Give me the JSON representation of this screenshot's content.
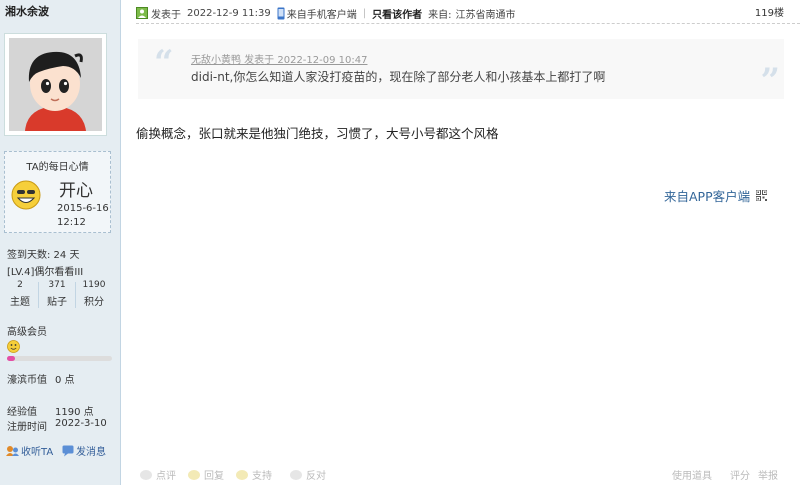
{
  "sidebar": {
    "username": "湘水余波",
    "mood": {
      "title": "TA的每日心情",
      "text": "开心",
      "date": "2015-6-16",
      "time": "12:12"
    },
    "sign_days": "签到天数: 24 天",
    "level": "[LV.4]偶尔看看III",
    "stats": [
      {
        "value": "2",
        "label": "主题"
      },
      {
        "value": "371",
        "label": "贴子"
      },
      {
        "value": "1190",
        "label": "积分"
      }
    ],
    "vip_label": "高级会员",
    "vip_progress": 0.08,
    "coins": {
      "label": "濠滨币值",
      "value": "0 点"
    },
    "exp": {
      "label": "经验值",
      "value": "1190 点"
    },
    "register": {
      "label": "注册时间",
      "value": "2022-3-10"
    },
    "actions": {
      "follow": "收听TA",
      "message": "发消息"
    }
  },
  "post": {
    "posted_label": "发表于",
    "posted_time": "2022-12-9 11:39",
    "client": "来自手机客户端",
    "only_author": "只看该作者",
    "from_label": "来自:",
    "location": "江苏省南通市",
    "floor": "119楼",
    "quote": {
      "header": "无敌小黄鸭 发表于 2022-12-09 10:47",
      "text": "didi-nt,你怎么知道人家没打疫苗的，现在除了部分老人和小孩基本上都打了啊"
    },
    "body": "偷换概念，张口就来是他独门绝技，习惯了，大号小号都这个风格",
    "app_link": "来自APP客户端"
  },
  "bottombar": {
    "comment": "点评",
    "reply": "回复",
    "support": "支持",
    "oppose": "反对",
    "tools": "使用道具",
    "rate": "评分",
    "report": "举报"
  },
  "colors": {
    "sidebar_bg": "#e5edf2",
    "link": "#336699",
    "progress": "#e34fa6"
  }
}
